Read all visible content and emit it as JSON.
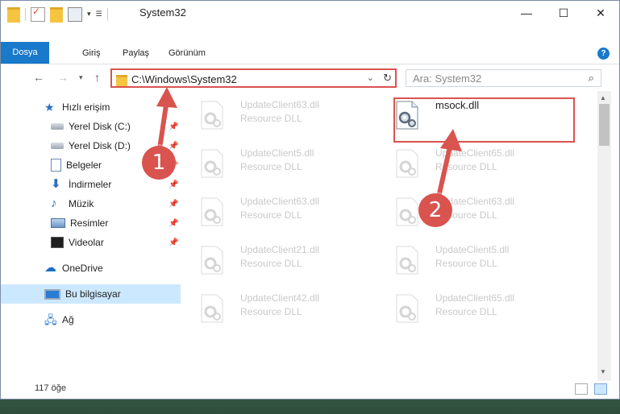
{
  "window": {
    "title": "System32",
    "caption": {
      "minimize": "—",
      "maximize": "☐",
      "close": "✕"
    }
  },
  "ribbon": {
    "tabs": [
      "Dosya",
      "Giriş",
      "Paylaş",
      "Görünüm"
    ],
    "help": "?"
  },
  "address": {
    "path": "C:\\Windows\\System32",
    "search_placeholder": "Ara: System32"
  },
  "sidebar": {
    "items": [
      {
        "label": "Hızlı erişim",
        "icon": "star-icon",
        "pinned": false
      },
      {
        "label": "Yerel Disk (C:)",
        "icon": "drive-icon",
        "pinned": true
      },
      {
        "label": "Yerel Disk (D:)",
        "icon": "drive-icon",
        "pinned": true
      },
      {
        "label": "Belgeler",
        "icon": "documents-icon",
        "pinned": true
      },
      {
        "label": "İndirmeler",
        "icon": "download-icon",
        "pinned": true
      },
      {
        "label": "Müzik",
        "icon": "music-icon",
        "pinned": true
      },
      {
        "label": "Resimler",
        "icon": "pictures-icon",
        "pinned": true
      },
      {
        "label": "Videolar",
        "icon": "videos-icon",
        "pinned": true
      },
      {
        "label": "OneDrive",
        "icon": "cloud-icon",
        "pinned": false
      },
      {
        "label": "Bu bilgisayar",
        "icon": "computer-icon",
        "pinned": false,
        "selected": true
      },
      {
        "label": "Ağ",
        "icon": "network-icon",
        "pinned": false
      }
    ]
  },
  "files": [
    {
      "name": "UpdateClient63.dll",
      "type": "Resource DLL"
    },
    {
      "name": "msock.dll",
      "type": ""
    },
    {
      "name": "UpdateClient5.dll",
      "type": "Resource DLL"
    },
    {
      "name": "UpdateClient65.dll",
      "type": "Resource DLL"
    },
    {
      "name": "UpdateClient63.dll",
      "type": "Resource DLL"
    },
    {
      "name": "UpdateClient63.dll",
      "type": "Resource DLL"
    },
    {
      "name": "UpdateClient21.dll",
      "type": "Resource DLL"
    },
    {
      "name": "UpdateClient5.dll",
      "type": "Resource DLL"
    },
    {
      "name": "UpdateClient42.dll",
      "type": "Resource DLL"
    },
    {
      "name": "UpdateClient65.dll",
      "type": "Resource DLL"
    }
  ],
  "status": {
    "item_count": "117 öğe"
  },
  "annotations": {
    "step1": "1",
    "step2": "2",
    "color": "#d9534f"
  }
}
